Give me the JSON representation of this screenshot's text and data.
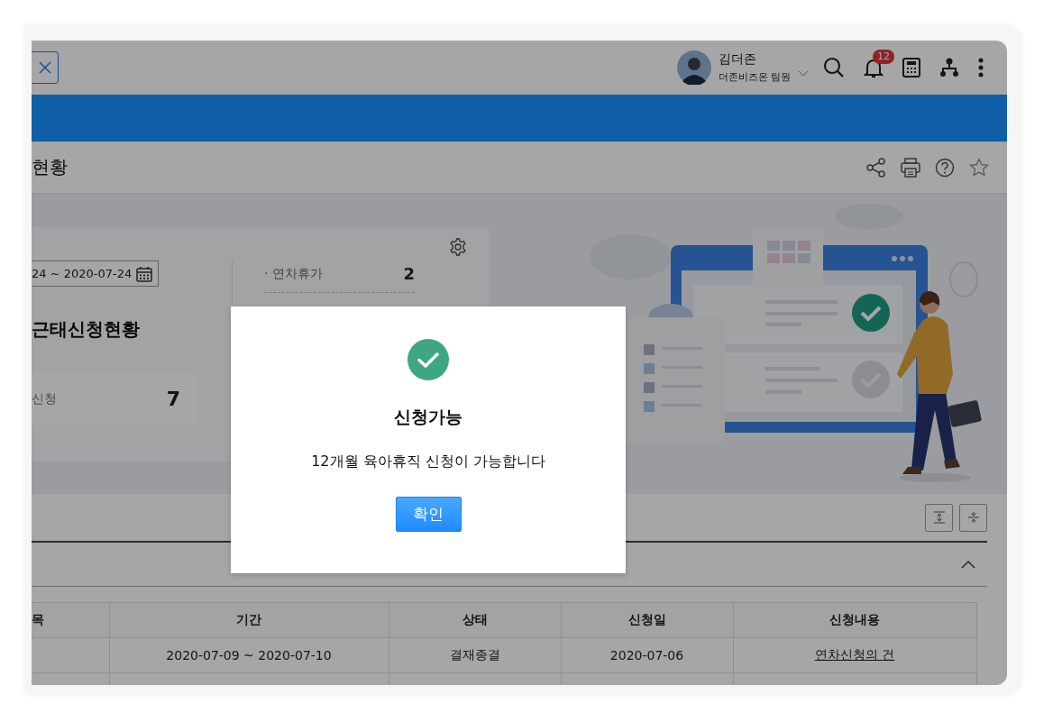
{
  "header": {
    "user": {
      "name": "김더존",
      "role": "더존비즈온 팀원"
    },
    "notification_count": "12"
  },
  "page": {
    "title": "현황",
    "favorite": false
  },
  "summary": {
    "date_range": "24 ~ 2020-07-24",
    "heading": "근태신청현황",
    "total": {
      "label": "신청",
      "value": "7"
    },
    "items": [
      {
        "label": "· 연차휴가",
        "value": "2"
      }
    ]
  },
  "section": {
    "expanded": true
  },
  "table": {
    "columns": [
      "목",
      "기간",
      "상태",
      "신청일",
      "신청내용"
    ],
    "rows": [
      {
        "period": "2020-07-09 ~ 2020-07-10",
        "status": "결재종결",
        "date": "2020-07-06",
        "content": "연차신청의 건"
      }
    ]
  },
  "dialog": {
    "title": "신청가능",
    "message": "12개월 육아휴직 신청이 가능합니다",
    "confirm": "확인"
  }
}
